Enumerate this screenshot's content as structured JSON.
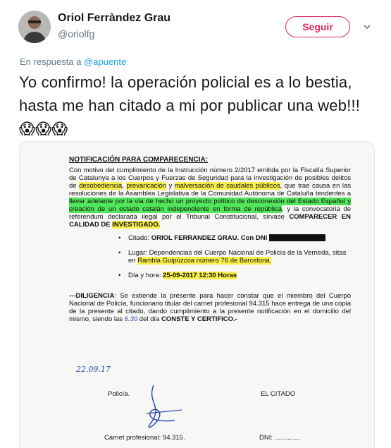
{
  "user": {
    "display_name": "Oriol Ferràndez Grau",
    "handle": "@oriolfg"
  },
  "follow_label": "Seguir",
  "reply": {
    "prefix": "En respuesta a ",
    "mention": "@apuente"
  },
  "tweet": {
    "text": "Yo confirmo! la operación policial es a lo bestia, hasta me han citado a mi por publicar una web!!! ",
    "emoji": "😱😱😱"
  },
  "document": {
    "title": "NOTIFICACIÓN PARA COMPARECENCIA:",
    "para_a": "Con motivo del cumplimiento de la Instrucción número 2/2017 emitida por la Fiscalía Superior de Catalunya a los Cuerpos y Fuerzas de Seguridad para la investigación de posibles delitos de ",
    "hl_1": "desobediencia",
    "sep_1": ", ",
    "hl_2": "prevaricación",
    "para_b": " y ",
    "hl_3": "malversación de caudales públicos",
    "para_c": ", que trae causa en las resoluciones de la Asamblea Legislativa de la Comunidad Autónoma de Cataluña tendentes a ",
    "hl_4": "llevar adelante por la vía de hecho un proyecto político de desconexión del Estado Español y creación de un estado catalán independiente en forma de república",
    "para_d": ", y la convocatoria de referendum declarada ilegal por el Tribunal Constitucional, sírvase ",
    "para_e": "COMPARECER EN CALIDAD DE ",
    "hl_5": "INVESTIGADO.",
    "citado_label": "Citado: ",
    "citado_value": "ORIOL FERRANDEZ GRAU. Con DNI",
    "lugar_label": "Lugar: Dependencias del Cuerpo Nacional de Policía de la Verneda, sitas en ",
    "lugar_hl": "Rambla Guipúzcoa número 76 de Barcelona.",
    "dia_label": "Día y hora: ",
    "dia_hl": "25-09-2017     12:30 Horas",
    "diligencia_a": "---DILIGENCIA",
    "diligencia_b": ": Se extiende la presente para hacer constar que el miembro del Cuerpo Nacional de Policía, funcionario titular del carnet profesional 94.315 hace entrega de una copia de la presente al citado, dando cumplimiento a la presente notificación en el domicilio del mismo, siendo las ",
    "diligencia_c": " del día ",
    "diligencia_d": " CONSTE Y CERTIFICO.-",
    "hand_time": "6.30",
    "hand_date": "22.09.17",
    "policia_label": "Policía.",
    "citado_sign_label": "EL CITADO",
    "carnet_label": "Carnet profesional: 94.315.",
    "dni_label": "DNI: .............."
  }
}
